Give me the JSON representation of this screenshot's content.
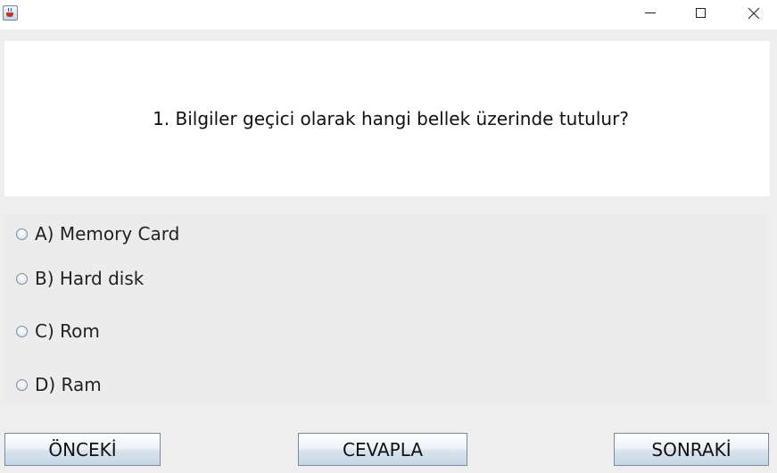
{
  "window": {
    "icon": "java-cup-icon",
    "controls": [
      "minimize-icon",
      "maximize-icon",
      "close-icon"
    ]
  },
  "question": {
    "text": "1. Bilgiler geçici olarak hangi bellek üzerinde tutulur?"
  },
  "options": [
    {
      "label": "A) Memory Card",
      "selected": false
    },
    {
      "label": "B) Hard disk",
      "selected": false
    },
    {
      "label": "C) Rom",
      "selected": false
    },
    {
      "label": "D) Ram",
      "selected": false
    }
  ],
  "buttons": {
    "previous": "ÖNCEKİ",
    "answer": "CEVAPLA",
    "next": "SONRAKİ"
  }
}
